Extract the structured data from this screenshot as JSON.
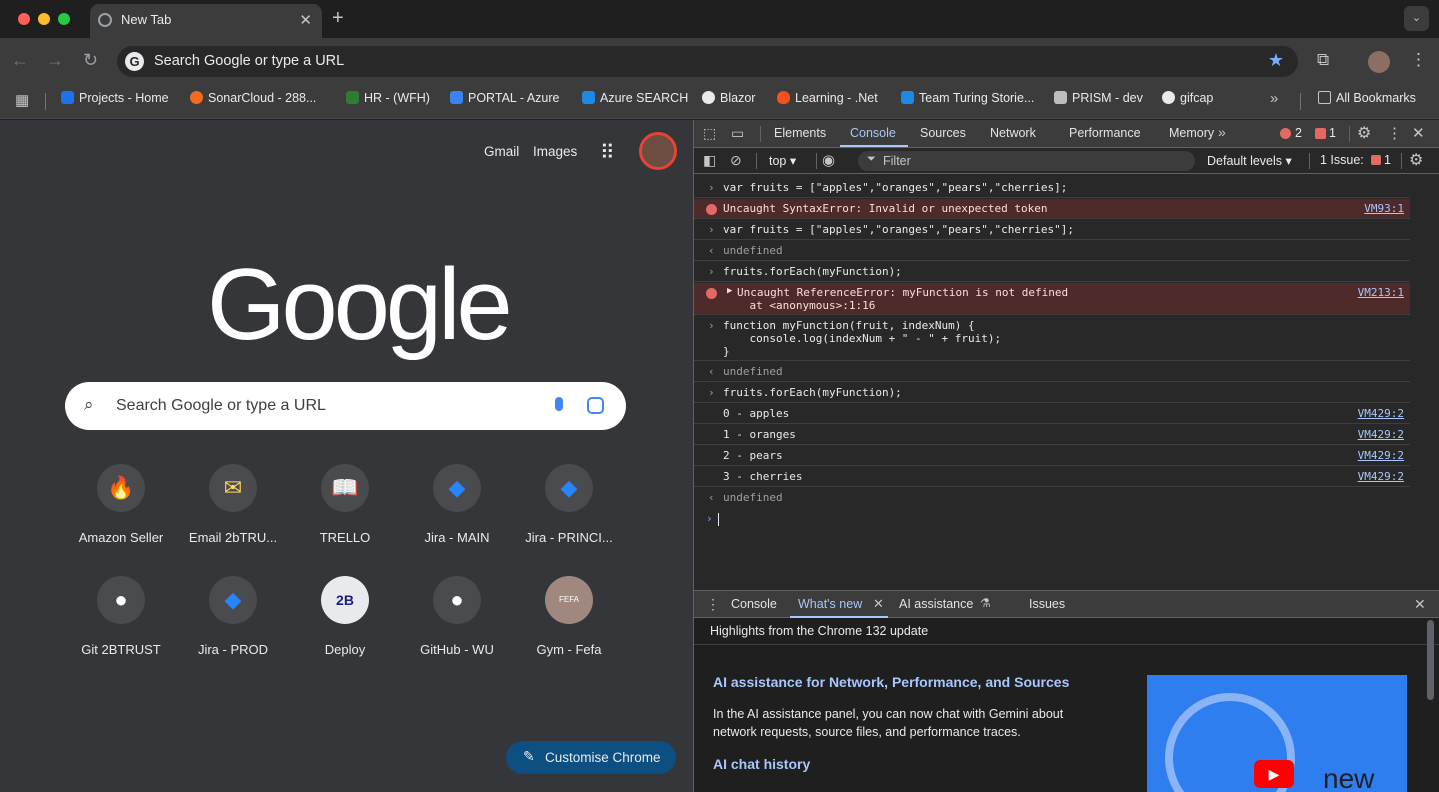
{
  "window": {
    "tab_title": "New Tab",
    "tab_close": "✕",
    "new_tab": "+"
  },
  "toolbar": {
    "omnibox_text": "Search Google or type a URL"
  },
  "bookmarks": {
    "items": [
      {
        "label": "Projects - Home",
        "color": "#1a73e8"
      },
      {
        "label": "SonarCloud - 288...",
        "color": "#f26b21"
      },
      {
        "label": "HR - (WFH)",
        "color": "#2e7d32"
      },
      {
        "label": "PORTAL - Azure",
        "color": "#3b82f6"
      },
      {
        "label": "Azure SEARCH",
        "color": "#1e88e5"
      },
      {
        "label": "Blazor",
        "color": "#e8eaed"
      },
      {
        "label": "Learning - .Net",
        "color": "#f4511e"
      },
      {
        "label": "Team Turing Storie...",
        "color": "#1e88e5"
      },
      {
        "label": "PRISM - dev",
        "color": "#bdbdbd"
      },
      {
        "label": "gifcap",
        "color": "#e8eaed"
      }
    ],
    "all_bookmarks": "All Bookmarks"
  },
  "ntp": {
    "gmail": "Gmail",
    "images": "Images",
    "logo": "Google",
    "search_placeholder": "Search Google or type a URL",
    "tiles": [
      {
        "label": "Amazon Seller",
        "icon": "flame-icon",
        "glyph": "🔥"
      },
      {
        "label": "Email 2bTRU...",
        "icon": "mail-icon",
        "glyph": "✉"
      },
      {
        "label": "TRELLO",
        "icon": "book-icon",
        "glyph": "📖"
      },
      {
        "label": "Jira - MAIN",
        "icon": "jira-icon",
        "glyph": "◆"
      },
      {
        "label": "Jira - PRINCI...",
        "icon": "jira-icon",
        "glyph": "◆"
      },
      {
        "label": "Git 2BTRUST",
        "icon": "github-icon",
        "glyph": "●"
      },
      {
        "label": "Jira - PROD",
        "icon": "jira-icon",
        "glyph": "◆"
      },
      {
        "label": "Deploy",
        "icon": "2b-icon",
        "glyph": "2B"
      },
      {
        "label": "GitHub - WU",
        "icon": "github-icon",
        "glyph": "●"
      },
      {
        "label": "Gym - Fefa",
        "icon": "fefa-icon",
        "glyph": "FEFA"
      }
    ],
    "customise": "Customise Chrome"
  },
  "devtools": {
    "tabs": [
      "Elements",
      "Console",
      "Sources",
      "Network",
      "Performance",
      "Memory"
    ],
    "active_tab": "Console",
    "error_count": "2",
    "issue_count": "1",
    "context": "top",
    "filter_placeholder": "Filter",
    "levels": "Default levels",
    "issues_label": "1 Issue:",
    "issues_num": "1",
    "console": {
      "l1": "var fruits = [\"apples\",\"oranges\",\"pears\",\"cherries];",
      "e1": "Uncaught SyntaxError: Invalid or unexpected token",
      "e1_src": "VM93:1",
      "l2": "var fruits = [\"apples\",\"oranges\",\"pears\",\"cherries\"];",
      "undef": "undefined",
      "l3": "fruits.forEach(myFunction);",
      "e2": "Uncaught ReferenceError: myFunction is not defined",
      "e2b": "    at <anonymous>:1:16",
      "e2_src": "VM213:1",
      "f1": "function myFunction(fruit, indexNum) {",
      "f2": "    console.log(indexNum + \" - \" + fruit);",
      "f3": "}",
      "o1": "0 - apples",
      "o2": "1 - oranges",
      "o3": "2 - pears",
      "o4": "3 - cherries",
      "o_src": "VM429:2"
    },
    "drawer": {
      "tabs": [
        "Console",
        "What's new",
        "AI assistance",
        "Issues"
      ],
      "highlights": "Highlights from the Chrome 132 update",
      "h1": "AI assistance for Network, Performance, and Sources",
      "p1": "In the AI assistance panel, you can now chat with Gemini about network requests, source files, and performance traces.",
      "h2": "AI chat history",
      "thumb_text": "new"
    }
  }
}
